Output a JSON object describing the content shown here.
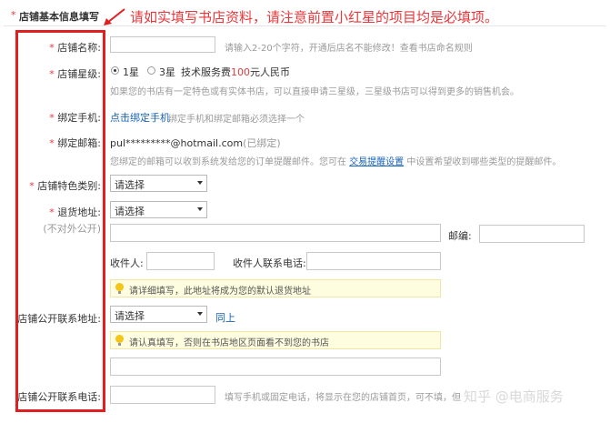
{
  "header": {
    "section_title": "店铺基本信息填写",
    "annotation": "请如实填写书店资料，请注意前置小红星的项目均是必填项。"
  },
  "form": {
    "required_mark": "*",
    "shop_name": {
      "label": "店铺名称:",
      "value": "",
      "hint": "请输入2-20个字符，开通后店名不能修改！查看书店命名规则"
    },
    "shop_level": {
      "label": "店铺星级:",
      "option_1": "1星",
      "option_2": "3星",
      "fee_prefix": "技术服务费",
      "fee_amount": "100",
      "fee_suffix": "元人民币",
      "note": "如果您的书店有一定特色或有实体书店，可以直接申请三星级，三星级书店可以得到更多的销售机会。"
    },
    "bind_phone": {
      "label": "绑定手机:",
      "link": "点击绑定手机",
      "note": "绑定手机和绑定邮箱必须选择一个"
    },
    "bind_email": {
      "label": "绑定邮箱:",
      "value": "pul*********@hotmail.com",
      "status": "(已绑定)",
      "note_prefix": "您绑定的邮箱可以收到系统发给您的订单提醒邮件。您可在",
      "note_link": "交易提醒设置",
      "note_suffix": "中设置希望收到哪些类型的提醒邮件。"
    },
    "shop_category": {
      "label": "店铺特色类别:",
      "selected": "请选择"
    },
    "return_address": {
      "label": "退货地址:",
      "sublabel": "(不对外公开)",
      "selected": "请选择",
      "street_value": "",
      "zip_label": "邮编:",
      "zip_value": "",
      "receiver_label": "收件人:",
      "receiver_value": "",
      "receiver_phone_label": "收件人联系电话:",
      "receiver_phone_value": "",
      "tip": "请详细填写，此地址将成为您的默认退货地址"
    },
    "public_address": {
      "label": "店铺公开联系地址:",
      "selected": "请选择",
      "same_link": "同上",
      "tip": "请认真填写，否则在书店地区页面看不到您的书店",
      "street_value": ""
    },
    "public_phone": {
      "label": "店铺公开联系电话:",
      "value": "",
      "hint": "填写手机或固定电话，将显示在您的店铺首页，可不填，但"
    }
  },
  "watermark": "知乎 @电商服务",
  "colors": {
    "annotation_red": "#e4393c",
    "highlight_box": "#e02020",
    "link_blue": "#1a64b8",
    "tip_bg": "#fffde0"
  }
}
